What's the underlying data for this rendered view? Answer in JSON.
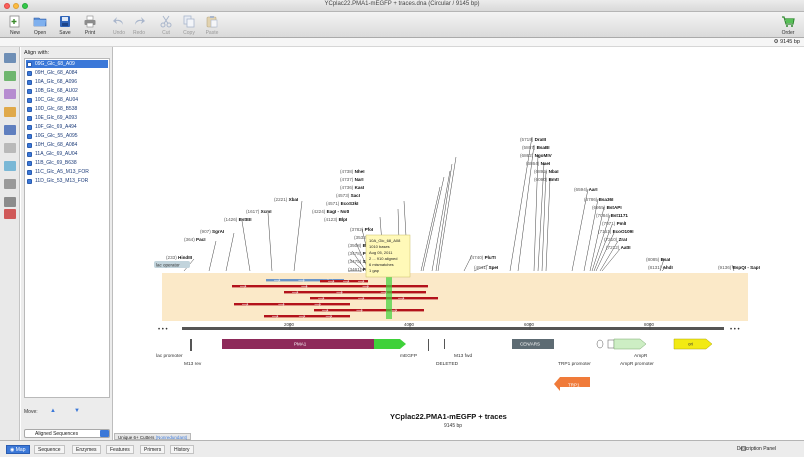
{
  "window": {
    "title": "YCplac22.PMA1-mEGFP + traces.dna  (Circular / 9145 bp)"
  },
  "toolbar": [
    {
      "key": "new",
      "label": "New",
      "enabled": true
    },
    {
      "key": "open",
      "label": "Open",
      "enabled": true
    },
    {
      "key": "save",
      "label": "Save",
      "enabled": true
    },
    {
      "key": "print",
      "label": "Print",
      "enabled": true
    },
    {
      "key": "undo",
      "label": "Undo",
      "enabled": false
    },
    {
      "key": "redo",
      "label": "Redo",
      "enabled": false
    },
    {
      "key": "cut",
      "label": "Cut",
      "enabled": false
    },
    {
      "key": "copy",
      "label": "Copy",
      "enabled": false
    },
    {
      "key": "paste",
      "label": "Paste",
      "enabled": false
    },
    {
      "key": "order",
      "label": "Order",
      "enabled": true
    }
  ],
  "zoom_readout": "9145 bp",
  "sidebar": {
    "header": "Align with:",
    "items": [
      "09G_Glc_68_A09",
      "09H_Glc_68_A084",
      "10A_Glc_68_A096",
      "10B_Glc_68_AU02",
      "10C_Glc_68_AU04",
      "10D_Glc_68_B538",
      "10E_Glc_69_A093",
      "10F_Glc_69_A494",
      "10G_Glc_55_A095",
      "10H_Glc_68_A084",
      "11A_Glc_69_AU04",
      "11B_Glc_69_B638",
      "11C_Glc_A5_M13_FOR",
      "11D_Glc_53_M13_FOR"
    ],
    "move_label": "Move:",
    "view_select": "Aligned Sequences"
  },
  "lower_tabs": [
    "Unique 6+ Cutters",
    "(Nonredundant)"
  ],
  "view_tabs": [
    "Map",
    "Sequence",
    "Enzymes",
    "Features",
    "Primers",
    "History"
  ],
  "active_view_tab": "Map",
  "description_panel": "Description Panel",
  "map": {
    "title": "YCplac22.PMA1-mEGFP + traces",
    "subtitle": "9145 bp",
    "ruler_ticks": [
      "2000",
      "4000",
      "6000",
      "8000"
    ],
    "enzymes": [
      {
        "name": "HindIII",
        "pos": "(233)"
      },
      {
        "name": "PacI",
        "pos": "(364)"
      },
      {
        "name": "SgrAI",
        "pos": "(907)"
      },
      {
        "name": "BstEII",
        "pos": "(1426)"
      },
      {
        "name": "XcmI",
        "pos": "(1617)"
      },
      {
        "name": "XbaI",
        "pos": "(2221)"
      },
      {
        "name": "PstI",
        "pos": "(3461)"
      },
      {
        "name": "SacI",
        "pos": "(3475)"
      },
      {
        "name": "PspXI",
        "pos": "(3478)"
      },
      {
        "name": "BsrGI",
        "pos": "(3508)"
      },
      {
        "name": "BamHI",
        "pos": "(3532)"
      },
      {
        "name": "PfoI",
        "pos": "(3782)"
      },
      {
        "name": "BlpI",
        "pos": "(4123)"
      },
      {
        "name": "EagI - NotI",
        "pos": "(4224)"
      },
      {
        "name": "EcoS3kI",
        "pos": "(4571)"
      },
      {
        "name": "SacI",
        "pos": "(4573)"
      },
      {
        "name": "KasI",
        "pos": "(4736)"
      },
      {
        "name": "NarI",
        "pos": "(4737)"
      },
      {
        "name": "NheI",
        "pos": "(4738)"
      },
      {
        "name": "PluTI",
        "pos": "(4740)"
      },
      {
        "name": "SpeI",
        "pos": "(4941)"
      },
      {
        "name": "DraIII",
        "pos": "(5719)"
      },
      {
        "name": "BsaBI",
        "pos": "(5867)"
      },
      {
        "name": "NgoMIV",
        "pos": "(6862)"
      },
      {
        "name": "NaeI",
        "pos": "(6864)"
      },
      {
        "name": "NbaI",
        "pos": "(6892)"
      },
      {
        "name": "BmtI",
        "pos": "(6090)"
      },
      {
        "name": "AarI",
        "pos": "(6594)"
      },
      {
        "name": "Bsa36I",
        "pos": "(6786)"
      },
      {
        "name": "BstAPI",
        "pos": "(6955)"
      },
      {
        "name": "Bst1171",
        "pos": "(7084)"
      },
      {
        "name": "PmlI",
        "pos": "(7071)"
      },
      {
        "name": "EcoO109I",
        "pos": "(7151)"
      },
      {
        "name": "ZraI",
        "pos": "(7210)"
      },
      {
        "name": "AatII",
        "pos": "(7212)"
      },
      {
        "name": "BsaI",
        "pos": "(8085)"
      },
      {
        "name": "AhdI",
        "pos": "(8131)"
      },
      {
        "name": "BspQI - SapI",
        "pos": "(9136)"
      }
    ],
    "tooltip": [
      "10A_Glc_68_A08",
      "1010 bases",
      "Aug 05, 2011",
      "2 ... 910 aligned",
      "6 mismatches",
      "1 gap"
    ],
    "features_above": [
      {
        "label": "lac operator"
      }
    ],
    "features_below": [
      {
        "label": "PMA1",
        "color": "#8e2a5a"
      },
      {
        "label": "mEGFP",
        "color": "#3fd13a"
      },
      {
        "label": "CEN/ARS",
        "color": "#5d6b73"
      },
      {
        "label": "AmpR",
        "color": "#cdeec4"
      },
      {
        "label": "ori",
        "color": "#f2ea14"
      },
      {
        "label": "TRP1",
        "color": "#f07b3a"
      }
    ],
    "feature_labels": [
      "lac promoter",
      "M13 rev",
      "mEGFP",
      "DELETED",
      "M13 fwd",
      "TRP1 promoter",
      "AmpR promoter",
      "AmpR"
    ]
  }
}
